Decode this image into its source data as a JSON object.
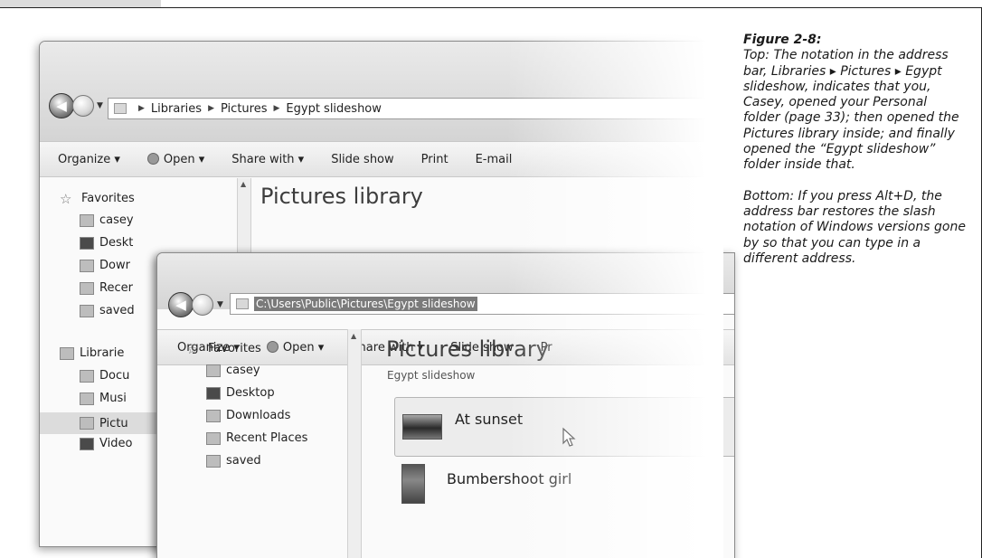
{
  "window_top": {
    "breadcrumb": [
      "Libraries",
      "Pictures",
      "Egypt slideshow"
    ],
    "toolbar": [
      "Organize ▾",
      "Open ▾",
      "Share with ▾",
      "Slide show",
      "Print",
      "E-mail"
    ],
    "nav_items": [
      "Favorites",
      "casey",
      "Deskt",
      "Dowr",
      "Recer",
      "saved"
    ],
    "library_title": "Pictures library"
  },
  "window_bottom": {
    "address_text": "C:\\Users\\Public\\Pictures\\Egypt slideshow",
    "toolbar": [
      "Organize ▾",
      "Open ▾",
      "Share with ▾",
      "Slide show",
      "Pr"
    ],
    "nav_items": [
      "Favorites",
      "casey",
      "Desktop",
      "Downloads",
      "Recent Places",
      "saved"
    ],
    "library_title": "Pictures library",
    "library_subtitle": "Egypt slideshow",
    "files": [
      "At sunset",
      "Bumbershoot girl"
    ]
  },
  "back_nav_items": [
    "Librarie",
    "Docu",
    "Musi",
    "Pictu",
    "Video"
  ],
  "caption": {
    "figure_label": "Figure 2-8:",
    "top_text": "Top: The notation in the address bar, Libraries ▸ Pictures ▸ Egypt slideshow, indicates that you, Casey, opened your Personal folder (page 33); then opened the Pictures library inside; and finally opened the “Egypt slideshow” folder inside that.",
    "bottom_text": "Bottom: If you press Alt+D, the address bar restores the slash notation of Windows versions gone by so that you can type in a different address."
  }
}
